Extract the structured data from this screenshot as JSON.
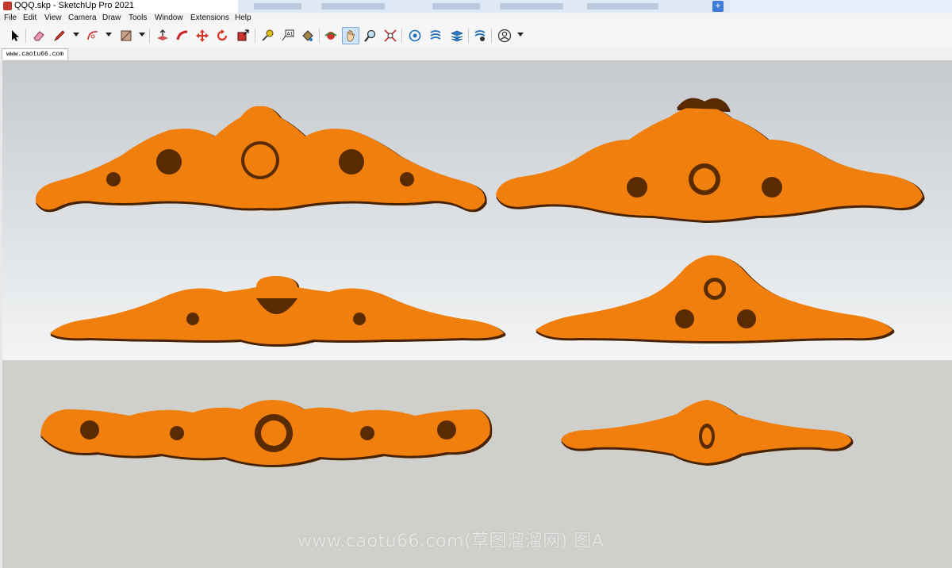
{
  "window": {
    "title": "QQQ.skp - SketchUp Pro 2021",
    "new_tab_symbol": "+"
  },
  "menu": [
    "File",
    "Edit",
    "View",
    "Camera",
    "Draw",
    "Tools",
    "Window",
    "Extensions",
    "Help"
  ],
  "toolbar": {
    "tools": [
      "select-icon",
      "eraser-icon",
      "pencil-line-icon",
      "arc-icon",
      "rectangle-icon",
      "push-pull-icon",
      "follow-me-icon",
      "move-icon",
      "rotate-icon",
      "scale-icon",
      "tape-measure-icon",
      "text-icon",
      "paint-bucket-icon",
      "orbit-icon",
      "pan-icon",
      "zoom-icon",
      "zoom-extents-icon",
      "3d-warehouse-icon",
      "extension-warehouse-icon",
      "layout-icon",
      "extension-manager-icon",
      "account-icon"
    ],
    "active_tool": "pan-icon"
  },
  "scene_tab": {
    "label": "www.caotu66.com"
  },
  "viewport": {
    "model_color": "#f07f0d",
    "model_shadow_color": "#5a2a05",
    "watermark": "www.caotu66.com(草图溜溜网) 图A"
  }
}
